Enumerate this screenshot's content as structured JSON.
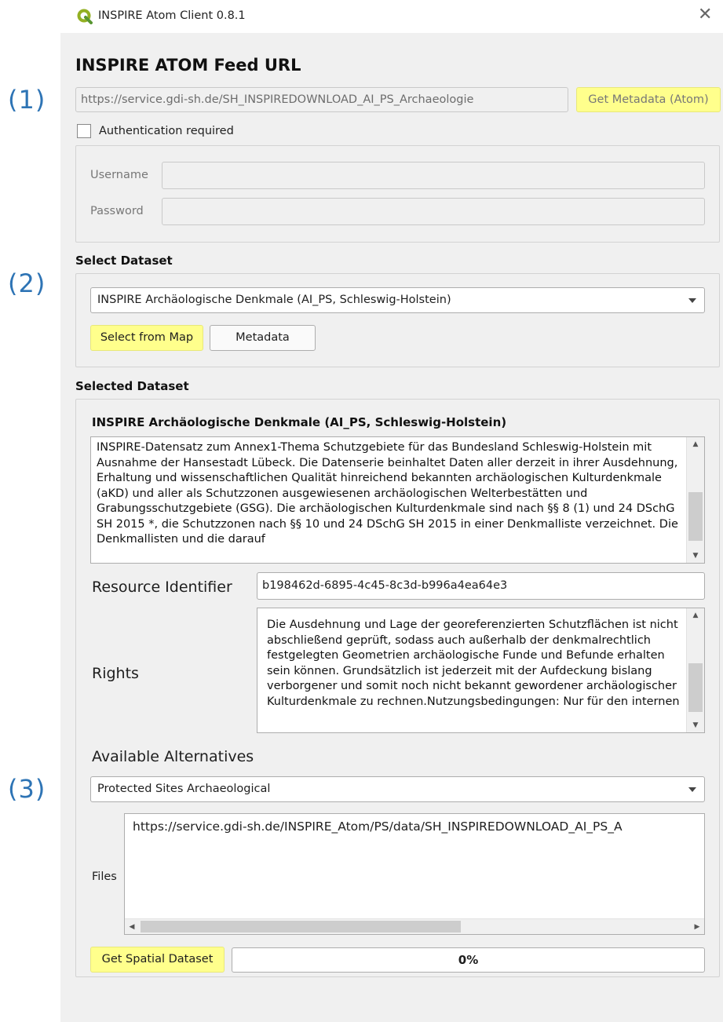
{
  "window": {
    "title": "INSPIRE Atom Client 0.8.1",
    "close_glyph": "✕",
    "icon": "qgis-logo-icon"
  },
  "annotations": [
    "(1)",
    "(2)",
    "(3)"
  ],
  "feed": {
    "heading": "INSPIRE ATOM Feed URL",
    "url": "https://service.gdi-sh.de/SH_INSPIREDOWNLOAD_AI_PS_Archaeologie",
    "get_metadata_label": "Get Metadata (Atom)",
    "auth_label": "Authentication required",
    "auth_checked": false,
    "username_label": "Username",
    "password_label": "Password"
  },
  "select_dataset": {
    "heading": "Select Dataset",
    "selected": "INSPIRE Archäologische Denkmale (AI_PS, Schleswig-Holstein)",
    "select_from_map_label": "Select from Map",
    "metadata_label": "Metadata"
  },
  "selected_dataset": {
    "heading": "Selected Dataset",
    "title": "INSPIRE Archäologische Denkmale (AI_PS, Schleswig-Holstein)",
    "description": "INSPIRE-Datensatz zum Annex1-Thema Schutzgebiete für das Bundesland Schleswig-Holstein mit Ausnahme der Hansestadt Lübeck. Die Datenserie beinhaltet Daten aller derzeit in ihrer Ausdehnung, Erhaltung und wissenschaftlichen Qualität hinreichend bekannten archäologischen Kulturdenkmale (aKD) und aller als Schutzzonen ausgewiesenen archäologischen Welterbestätten und Grabungsschutzgebiete (GSG). Die archäologischen Kulturdenkmale sind nach §§ 8 (1) und 24 DSchG SH 2015 *, die Schutzzonen nach §§ 10 und 24 DSchG SH 2015 in einer Denkmalliste verzeichnet. Die Denkmallisten und die darauf",
    "resource_identifier_label": "Resource Identifier",
    "resource_identifier": "b198462d-6895-4c45-8c3d-b996a4ea64e3",
    "rights_label": "Rights",
    "rights": "Die Ausdehnung und Lage der georeferenzierten Schutzflächen ist nicht abschließend geprüft, sodass auch außerhalb der denkmalrechtlich festgelegten Geometrien archäologische Funde und Befunde erhalten sein können. Grundsätzlich ist jederzeit mit der Aufdeckung bislang verborgener und somit noch nicht bekannt gewordener archäologischer Kulturdenkmale zu rechnen.Nutzungsbedingungen: Nur für den internen",
    "alternatives_label": "Available Alternatives",
    "alternative_selected": "Protected Sites Archaeological",
    "files_label": "Files",
    "files": [
      "https://service.gdi-sh.de/INSPIRE_Atom/PS/data/SH_INSPIREDOWNLOAD_AI_PS_A"
    ],
    "get_spatial_label": "Get Spatial Dataset",
    "progress_text": "0%",
    "progress_value": 0
  },
  "colors": {
    "highlight": "#ffff8c",
    "annotation": "#2e74b5",
    "qgis_green": "#93b023"
  }
}
